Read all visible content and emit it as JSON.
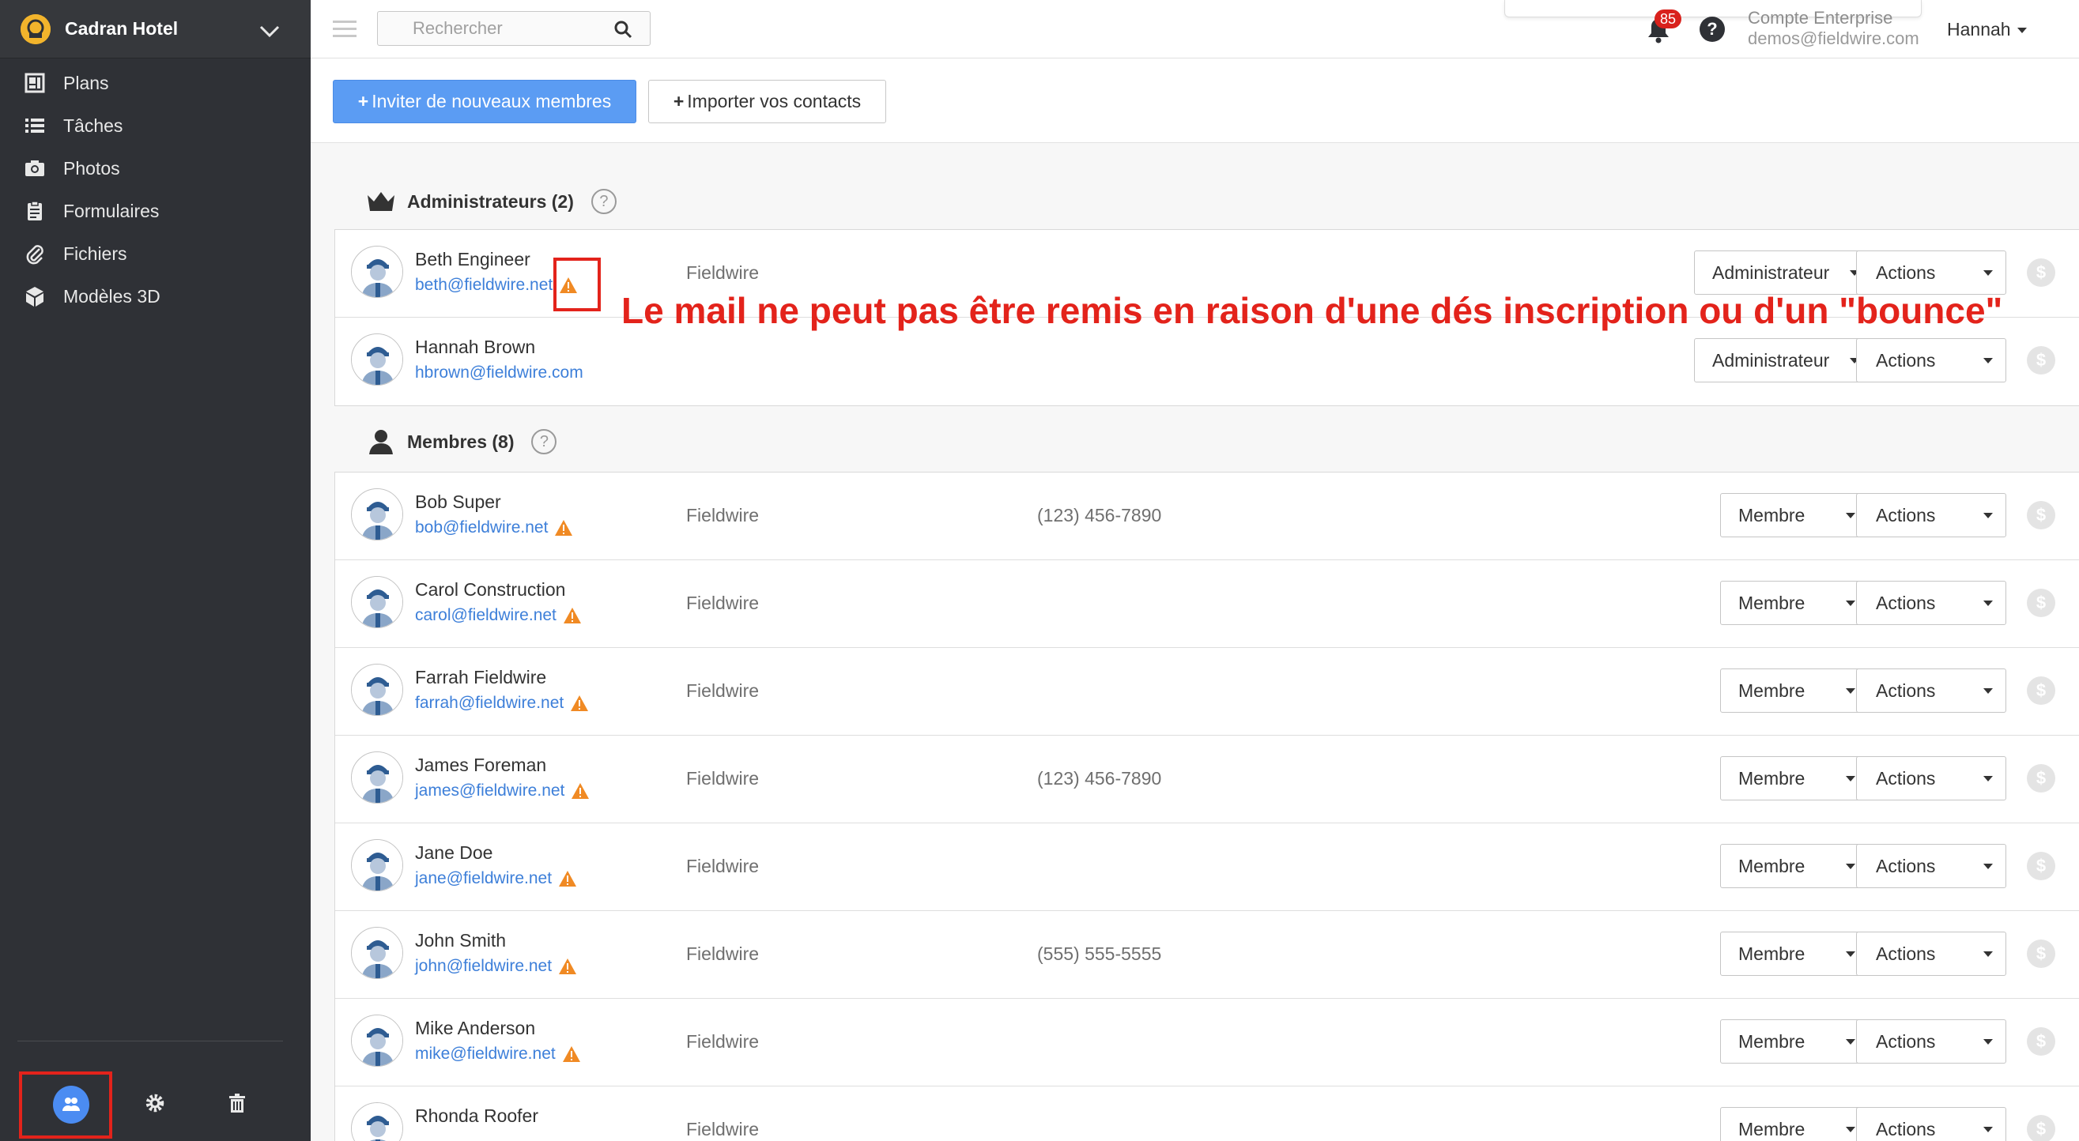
{
  "sidebar": {
    "project_name": "Cadran Hotel",
    "items": [
      {
        "label": "Plans",
        "icon": "plans-icon"
      },
      {
        "label": "Tâches",
        "icon": "list-icon"
      },
      {
        "label": "Photos",
        "icon": "camera-icon"
      },
      {
        "label": "Formulaires",
        "icon": "clipboard-icon"
      },
      {
        "label": "Fichiers",
        "icon": "paperclip-icon"
      },
      {
        "label": "Modèles 3D",
        "icon": "cube-icon"
      }
    ],
    "footer_icons": [
      "users-icon",
      "gear-icon",
      "trash-icon"
    ]
  },
  "topbar": {
    "search_placeholder": "Rechercher",
    "notification_count": "85",
    "help": "?",
    "account_type": "Compte Enterprise",
    "account_email": "demos@fieldwire.com",
    "user_name": "Hannah"
  },
  "toolbar": {
    "invite_label": "Inviter de nouveaux membres",
    "import_label": "Importer vos contacts"
  },
  "admins": {
    "title": "Administrateurs (2)",
    "rows": [
      {
        "name": "Beth Engineer",
        "email": "beth@fieldwire.net",
        "company": "Fieldwire",
        "phone": "",
        "role": "Administrateur",
        "actions": "Actions",
        "warn": true
      },
      {
        "name": "Hannah Brown",
        "email": "hbrown@fieldwire.com",
        "company": "",
        "phone": "",
        "role": "Administrateur",
        "actions": "Actions",
        "warn": false
      }
    ]
  },
  "members": {
    "title": "Membres (8)",
    "rows": [
      {
        "name": "Bob Super",
        "email": "bob@fieldwire.net",
        "company": "Fieldwire",
        "phone": "(123) 456-7890",
        "role": "Membre",
        "actions": "Actions",
        "warn": true
      },
      {
        "name": "Carol Construction",
        "email": "carol@fieldwire.net",
        "company": "Fieldwire",
        "phone": "",
        "role": "Membre",
        "actions": "Actions",
        "warn": true
      },
      {
        "name": "Farrah Fieldwire",
        "email": "farrah@fieldwire.net",
        "company": "Fieldwire",
        "phone": "",
        "role": "Membre",
        "actions": "Actions",
        "warn": true
      },
      {
        "name": "James Foreman",
        "email": "james@fieldwire.net",
        "company": "Fieldwire",
        "phone": "(123) 456-7890",
        "role": "Membre",
        "actions": "Actions",
        "warn": true
      },
      {
        "name": "Jane Doe",
        "email": "jane@fieldwire.net",
        "company": "Fieldwire",
        "phone": "",
        "role": "Membre",
        "actions": "Actions",
        "warn": true
      },
      {
        "name": "John Smith",
        "email": "john@fieldwire.net",
        "company": "Fieldwire",
        "phone": "(555) 555-5555",
        "role": "Membre",
        "actions": "Actions",
        "warn": true
      },
      {
        "name": "Mike Anderson",
        "email": "mike@fieldwire.net",
        "company": "Fieldwire",
        "phone": "",
        "role": "Membre",
        "actions": "Actions",
        "warn": true
      },
      {
        "name": "Rhonda Roofer",
        "email": "",
        "company": "Fieldwire",
        "phone": "",
        "role": "Membre",
        "actions": "Actions",
        "warn": false
      }
    ]
  },
  "annotation": "Le mail ne peut pas être remis en raison d'une dés inscription ou d'un \"bounce\"",
  "colors": {
    "sidebar_bg": "#2f3136",
    "primary_button": "#5b9cf3",
    "link": "#3d7fd9",
    "warning": "#f08a24",
    "annotation_red": "#e3231b"
  }
}
